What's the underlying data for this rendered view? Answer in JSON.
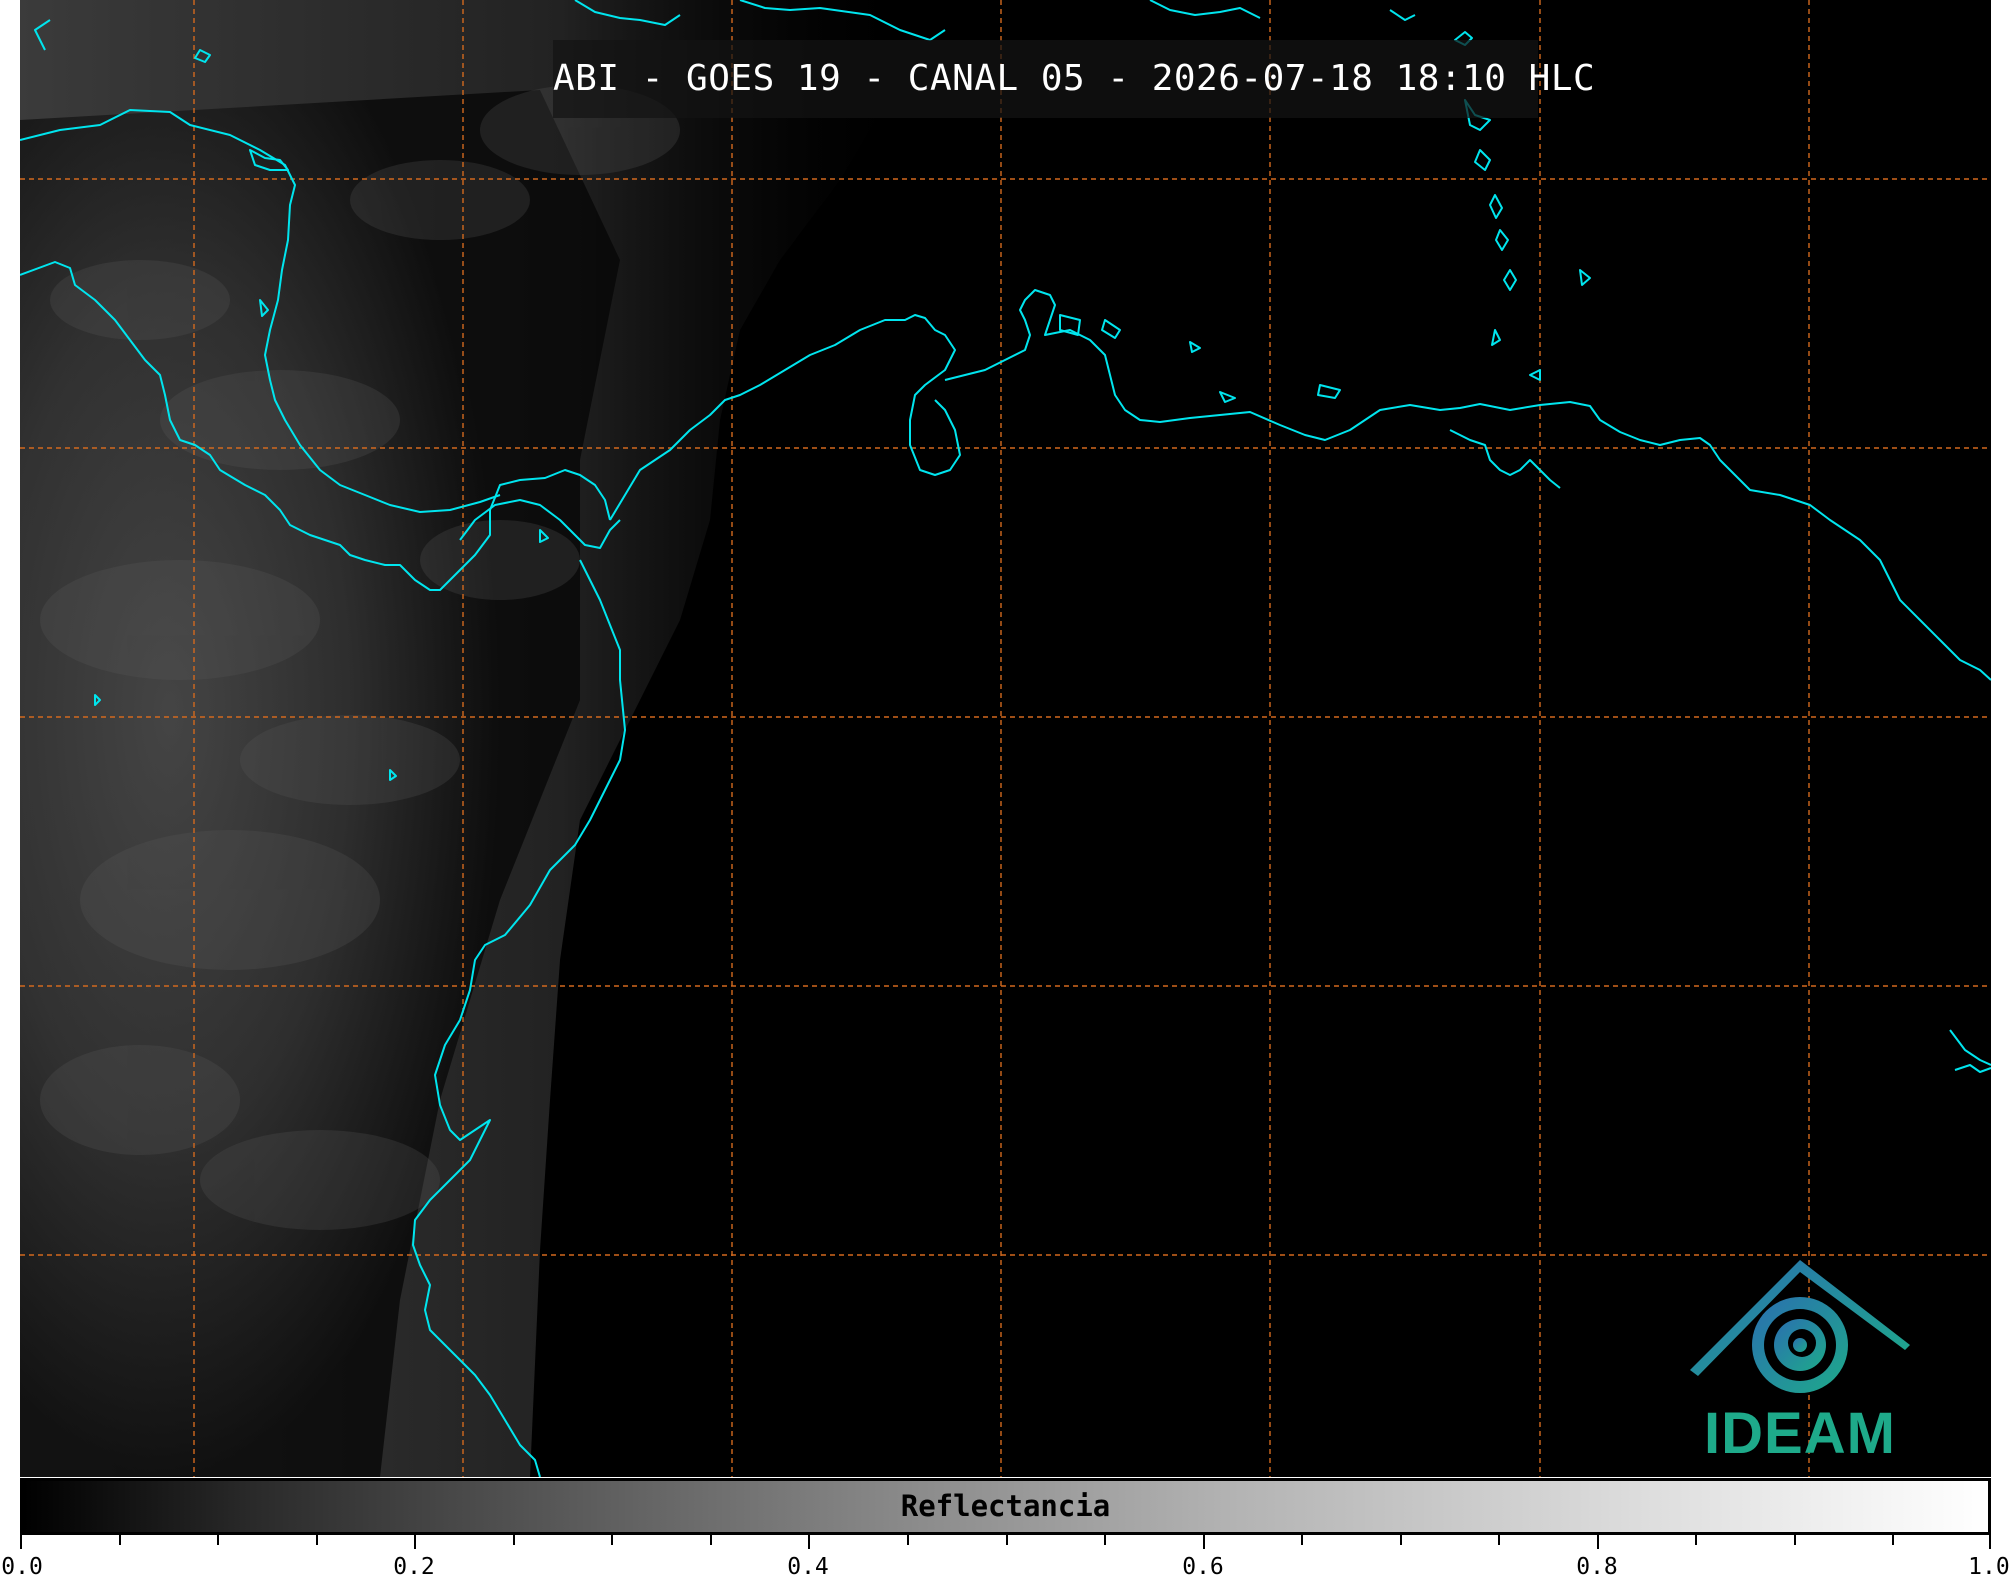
{
  "map": {
    "title": "ABI - GOES 19 - CANAL 05 - 2026-07-18 18:10 HLC",
    "colors": {
      "background": "#000000",
      "coastline": "#00e5ee",
      "grid": "#d2691e"
    }
  },
  "colorbar": {
    "label": "Reflectancia",
    "range": [
      0.0,
      1.0
    ],
    "tick_labels": [
      "0.0",
      "0.2",
      "0.4",
      "0.6",
      "0.8",
      "1.0"
    ]
  },
  "logo": {
    "text": "IDEAM",
    "colors": {
      "primary": "#1eaa8a",
      "secondary": "#2a6fb0"
    }
  }
}
